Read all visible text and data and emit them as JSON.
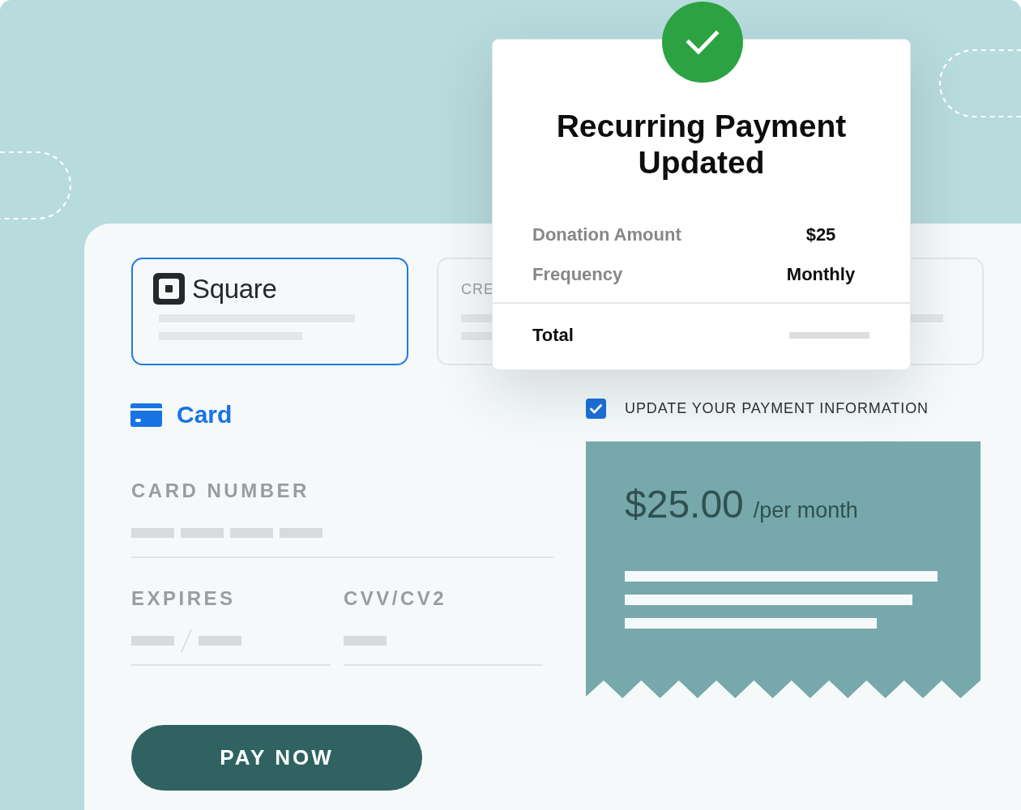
{
  "payment_options": [
    {
      "kind": "logo",
      "label": "Square",
      "selected": true
    },
    {
      "kind": "text",
      "label": "CRE",
      "selected": false
    }
  ],
  "method": {
    "label": "Card"
  },
  "fields": [
    {
      "kind": "card_number",
      "label": "CARD NUMBER"
    },
    {
      "kind": "expiry",
      "label": "EXPIRES"
    },
    {
      "kind": "cvv",
      "label": "CVV/CV2"
    }
  ],
  "pay_button": {
    "label": "PAY NOW"
  },
  "update_option": {
    "label": "UPDATE YOUR PAYMENT INFORMATION",
    "checked": true
  },
  "receipt": {
    "amount": "$25.00",
    "period": "/per month"
  },
  "dialog": {
    "title": "Recurring Payment Updated",
    "rows": [
      {
        "label": "Donation Amount",
        "value": "$25"
      },
      {
        "label": "Frequency",
        "value": "Monthly"
      }
    ],
    "total": {
      "label": "Total"
    }
  }
}
